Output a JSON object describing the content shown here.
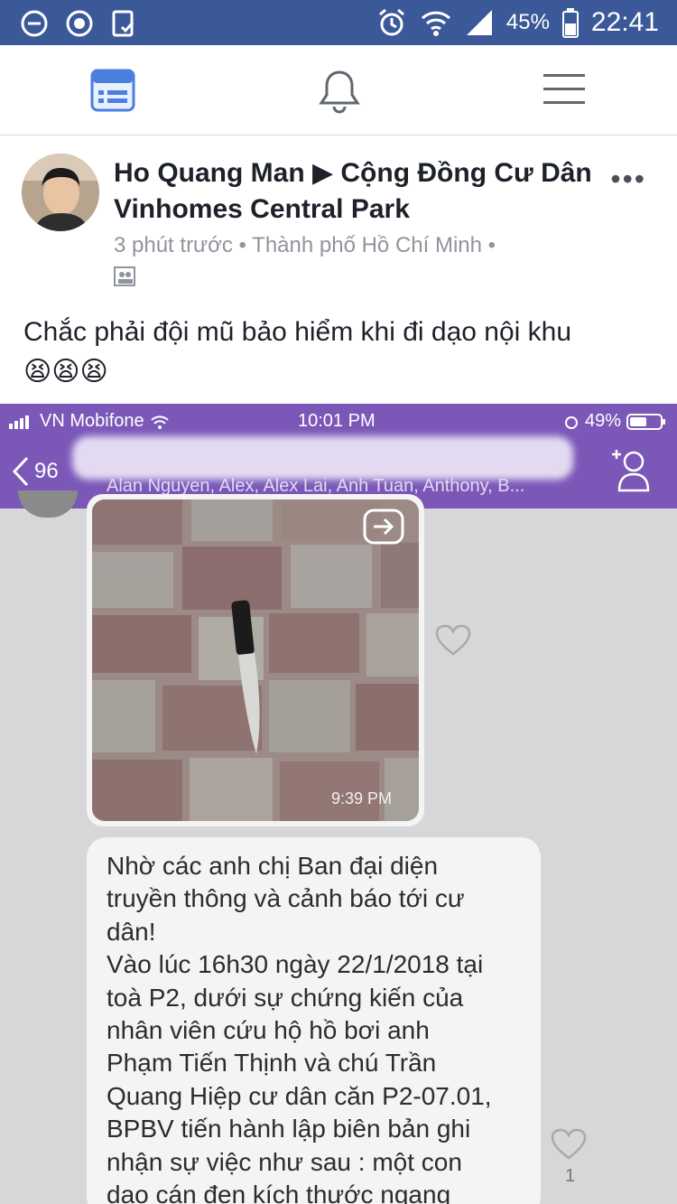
{
  "status_bar": {
    "battery": "45%",
    "time": "22:41",
    "icons": [
      "dnd-icon",
      "power-save-icon",
      "screenshot-icon",
      "alarm-icon",
      "wifi-icon",
      "signal-icon",
      "battery-icon"
    ]
  },
  "nav": {
    "icons": [
      "news-feed-icon",
      "notifications-bell-icon",
      "menu-icon"
    ],
    "accent": "#3b5998"
  },
  "post": {
    "author": "Ho Quang Man ▶ Cộng Đồng Cư Dân Vinhomes Central Park",
    "meta": "3 phút trước • Thành phố Hồ Chí Minh •",
    "more": "•••",
    "text": "Chắc phải đội mũ bảo hiểm khi đi dạo nội khu",
    "emoji": "😫😫😫"
  },
  "screenshot": {
    "carrier": "VN Mobifone",
    "time": "10:01 PM",
    "battery": "49%",
    "back_count": "96",
    "members": "Alan Nguyen, Alex, Alex Lai, Anh Tuan, Anthony, B...",
    "header_color": "#7b58b8",
    "photo_time": "9:39 PM",
    "message_lines": [
      "Nhờ các anh chị Ban đại diện",
      "truyền thông và cảnh báo tới cư",
      "dân!",
      "Vào lúc 16h30 ngày 22/1/2018 tại",
      "toà P2, dưới sự chứng kiến của",
      "nhân viên cứu hộ hồ bơi anh",
      "Phạm Tiến Thịnh và chú Trần",
      "Quang Hiệp cư dân căn P2-07.01,",
      "BPBV tiến hành lập biên bản ghi",
      "nhận sự việc như sau : một con",
      "dao cán đen kích thước ngang"
    ],
    "like_count": "1"
  }
}
